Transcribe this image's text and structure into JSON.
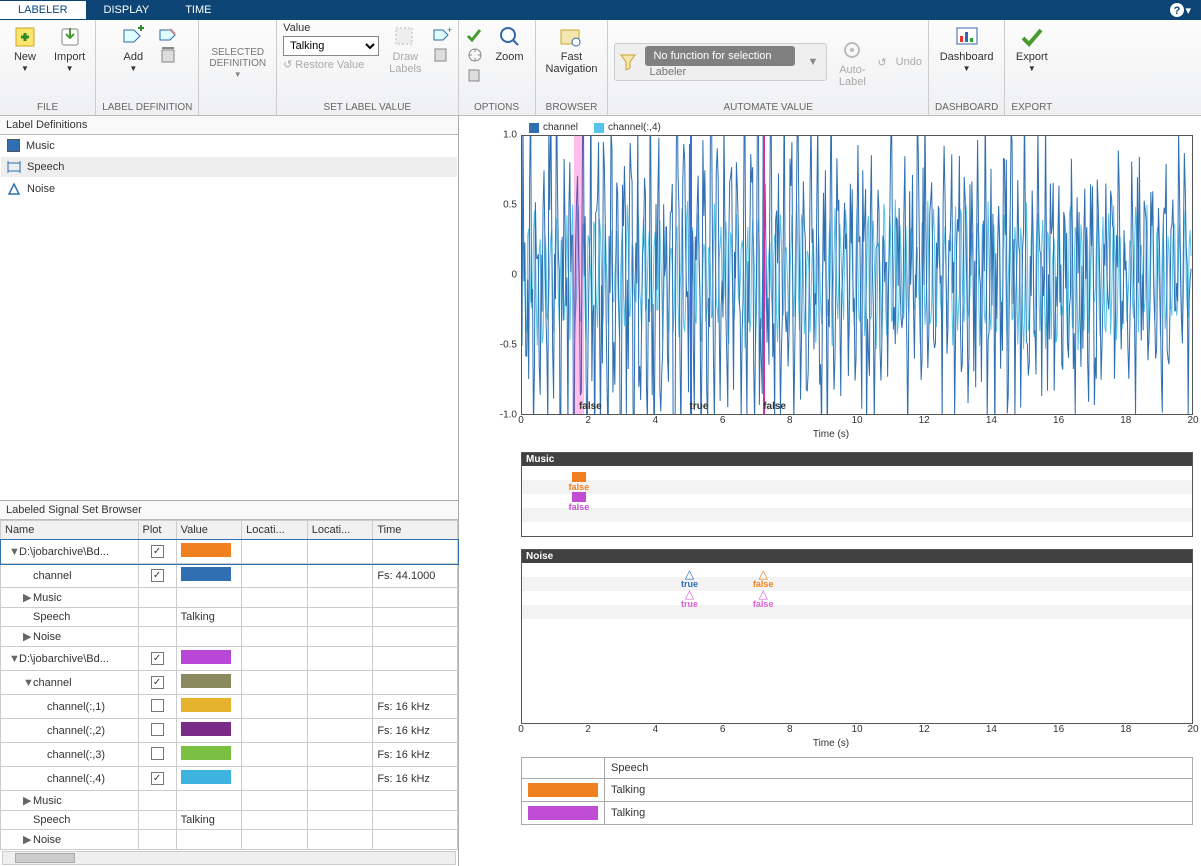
{
  "tabs": {
    "labeler": "LABELER",
    "display": "DISPLAY",
    "time": "TIME"
  },
  "ribbon": {
    "file": {
      "new": "New",
      "import": "Import",
      "group": "FILE"
    },
    "labeldef": {
      "add": "Add",
      "group": "LABEL DEFINITION"
    },
    "seldef": {
      "label": "SELECTED\nDEFINITION"
    },
    "setval": {
      "value_lbl": "Value",
      "value": "Talking",
      "restore": "Restore Value",
      "draw": "Draw\nLabels",
      "group": "SET LABEL VALUE"
    },
    "options": {
      "zoom": "Zoom",
      "group": "OPTIONS"
    },
    "browser": {
      "fast": "Fast\nNavigation",
      "group": "BROWSER"
    },
    "auto": {
      "nofunc": "No function for selection",
      "labeler": "Labeler",
      "autolbl": "Auto-\nLabel",
      "undo": "Undo",
      "group": "AUTOMATE VALUE"
    },
    "dash": {
      "label": "Dashboard",
      "group": "DASHBOARD"
    },
    "export": {
      "label": "Export",
      "group": "EXPORT"
    }
  },
  "labelDefs": {
    "title": "Label Definitions",
    "items": [
      {
        "name": "Music",
        "type": "square",
        "color": "#2f6fb2"
      },
      {
        "name": "Speech",
        "type": "bar",
        "color": "#2f6fb2",
        "selected": true
      },
      {
        "name": "Noise",
        "type": "tri",
        "color": "#2f6fb2"
      }
    ]
  },
  "lsBrowser": {
    "title": "Labeled Signal Set Browser",
    "cols": [
      "Name",
      "Plot",
      "Value",
      "Locati...",
      "Locati...",
      "Time"
    ],
    "rows": [
      {
        "indent": 0,
        "caret": "▼",
        "name": "D:\\jobarchive\\Bd...",
        "plot": true,
        "color": "#f08020",
        "sel": true
      },
      {
        "indent": 1,
        "caret": "",
        "name": "channel",
        "plot": true,
        "color": "#2f6fb2",
        "time": "Fs: 44.1000"
      },
      {
        "indent": 1,
        "caret": "▶",
        "name": "Music"
      },
      {
        "indent": 1,
        "caret": "",
        "name": "Speech",
        "value": "Talking"
      },
      {
        "indent": 1,
        "caret": "▶",
        "name": "Noise"
      },
      {
        "indent": 0,
        "caret": "▼",
        "name": "D:\\jobarchive\\Bd...",
        "plot": true,
        "color": "#b846d7"
      },
      {
        "indent": 1,
        "caret": "▼",
        "name": "channel",
        "plot": true,
        "color": "#8b8a5e"
      },
      {
        "indent": 2,
        "caret": "",
        "name": "channel(:,1)",
        "plot": false,
        "color": "#e5b32e",
        "time": "Fs: 16 kHz"
      },
      {
        "indent": 2,
        "caret": "",
        "name": "channel(:,2)",
        "plot": false,
        "color": "#7a2a87",
        "time": "Fs: 16 kHz"
      },
      {
        "indent": 2,
        "caret": "",
        "name": "channel(:,3)",
        "plot": false,
        "color": "#7bc043",
        "time": "Fs: 16 kHz"
      },
      {
        "indent": 2,
        "caret": "",
        "name": "channel(:,4)",
        "plot": true,
        "color": "#3fb3df",
        "time": "Fs: 16 kHz"
      },
      {
        "indent": 1,
        "caret": "▶",
        "name": "Music"
      },
      {
        "indent": 1,
        "caret": "",
        "name": "Speech",
        "value": "Talking"
      },
      {
        "indent": 1,
        "caret": "▶",
        "name": "Noise"
      }
    ]
  },
  "legend": {
    "a": "channel",
    "b": "channel(:,4)",
    "acolor": "#2f6fb2",
    "bcolor": "#55c6ea"
  },
  "xlabel": "Time (s)",
  "xticks": [
    "0",
    "2",
    "4",
    "6",
    "8",
    "10",
    "12",
    "14",
    "16",
    "18",
    "20"
  ],
  "yticks": [
    "1.0",
    "0.5",
    "0",
    "-0.5",
    "-1.0"
  ],
  "annots": [
    {
      "t": 1.7,
      "text": "false"
    },
    {
      "t": 5.0,
      "text": "true"
    },
    {
      "t": 7.2,
      "text": "false"
    }
  ],
  "mn1": {
    "title": "Music",
    "marks": [
      {
        "t": 1.7,
        "text": "false",
        "color": "#f08020",
        "type": "sw"
      },
      {
        "t": 1.7,
        "text": "false",
        "color": "#c04dd4",
        "type": "sw",
        "row": 1
      }
    ]
  },
  "mn2": {
    "title": "Noise",
    "marks": [
      {
        "t": 5.0,
        "text": "true",
        "color": "#2f6fb2",
        "type": "tri"
      },
      {
        "t": 7.2,
        "text": "false",
        "color": "#f08020",
        "type": "tri"
      },
      {
        "t": 5.0,
        "text": "true",
        "color": "#d95fd6",
        "type": "tri",
        "row": 1
      },
      {
        "t": 7.2,
        "text": "false",
        "color": "#d95fd6",
        "type": "tri",
        "row": 1
      }
    ]
  },
  "info": {
    "header": "Speech",
    "rows": [
      {
        "color": "#f08020",
        "text": "Talking"
      },
      {
        "color": "#c04dd4",
        "text": "Talking"
      }
    ]
  },
  "chart_data": {
    "type": "line",
    "title": "",
    "xlabel": "Time (s)",
    "ylabel": "",
    "xlim": [
      0,
      20
    ],
    "ylim": [
      -1.0,
      1.0
    ],
    "series": [
      {
        "name": "channel",
        "color": "#2f6fb2",
        "note": "audio waveform, dense oscillation approx range -1.0..1.0 over 0-20s"
      },
      {
        "name": "channel(:,4)",
        "color": "#55c6ea",
        "note": "audio waveform, dense oscillation approx range -0.5..0.5 over 0-20s"
      }
    ],
    "region_markers": [
      {
        "t": 1.7,
        "label": "false",
        "kind": "band",
        "color": "#e54fcf"
      },
      {
        "t": 5.0,
        "label": "true",
        "kind": "line",
        "color": "#3a6ed4"
      },
      {
        "t": 7.2,
        "label": "false",
        "kind": "line",
        "color": "#d42fa2"
      }
    ]
  }
}
